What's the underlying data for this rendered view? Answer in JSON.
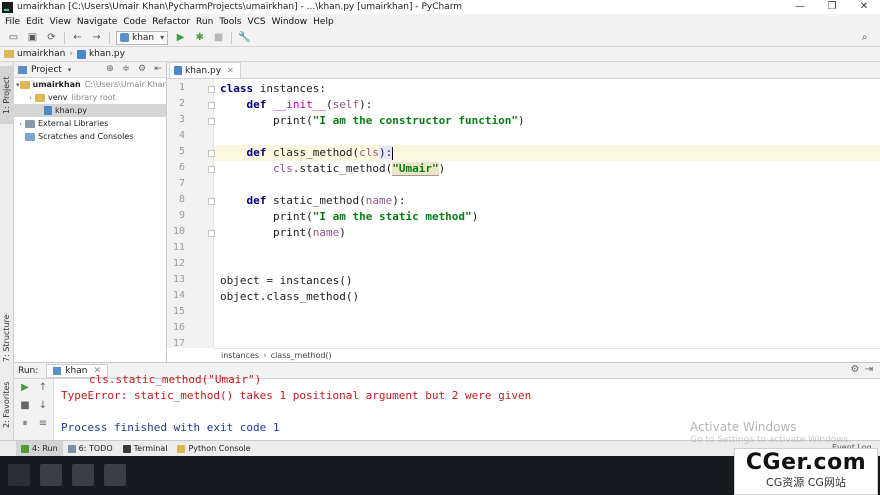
{
  "window": {
    "title": "umairkhan [C:\\Users\\Umair Khan\\PycharmProjects\\umairkhan] - ...\\khan.py [umairkhan] - PyCharm",
    "controls": [
      "—",
      "❐",
      "✕"
    ]
  },
  "menu": [
    "File",
    "Edit",
    "View",
    "Navigate",
    "Code",
    "Refactor",
    "Run",
    "Tools",
    "VCS",
    "Window",
    "Help"
  ],
  "toolbar": {
    "run_config": "khan"
  },
  "navbar": {
    "project": "umairkhan",
    "file": "khan.py"
  },
  "left_strip": {
    "project_tab": "1: Project",
    "structure_tab": "7: Structure",
    "favorites_tab": "2: Favorites"
  },
  "project_panel": {
    "title": "Project",
    "tree": {
      "root_name": "umairkhan",
      "root_path": "C:\\Users\\Umair Khan\\PycharmProjects\\umairkhan",
      "venv_name": "venv",
      "venv_note": "library root",
      "file_name": "khan.py",
      "external_libs": "External Libraries",
      "scratches": "Scratches and Consoles"
    }
  },
  "editor": {
    "tab_label": "khan.py",
    "line_numbers": [
      "1",
      "2",
      "3",
      "4",
      "5",
      "6",
      "7",
      "8",
      "9",
      "10",
      "11",
      "12",
      "13",
      "14",
      "15",
      "16",
      "17"
    ],
    "code": {
      "l1_kw": "class",
      "l1_rest": " instances:",
      "l2_kw": "def",
      "l2_name": "__init__",
      "l2_open": "(",
      "l2_self": "self",
      "l2_close": "):",
      "l3_call": "print(",
      "l3_str": "\"I am the constructor function\"",
      "l3_end": ")",
      "l5_kw": "def",
      "l5_name": " class_method(",
      "l5_param": "cls",
      "l5_end": "):",
      "l6_obj": "cls",
      "l6_call": ".static_method(",
      "l6_str": "\"Umair\"",
      "l6_end": ")",
      "l8_kw": "def",
      "l8_name": " static_method(",
      "l8_param": "name",
      "l8_end": "):",
      "l9_call": "print(",
      "l9_str": "\"I am the static method\"",
      "l9_end": ")",
      "l10_call": "print(",
      "l10_param": "name",
      "l10_end": ")",
      "l13": "object = instances()",
      "l14": "object.class_method()"
    },
    "breadcrumb_class": "instances",
    "breadcrumb_method": "class_method()"
  },
  "run_panel": {
    "label": "Run:",
    "tab": "khan",
    "console": {
      "cut_line": "cls.static_method(\"Umair\")",
      "error_line": "TypeError: static_method() takes 1 positional argument but 2 were given",
      "finish_line": "Process finished with exit code 1"
    }
  },
  "bottom_tabs": [
    "4: Run",
    "6: TODO",
    "Terminal",
    "Python Console"
  ],
  "overlay": {
    "activate_title": "Activate Windows",
    "activate_sub": "Go to Settings to activate Windows.",
    "event_log": "Event Log"
  },
  "badge": {
    "brand": "CGer.com",
    "sub": "CG资源 CG网站"
  },
  "colors": {
    "keyword": "#000080",
    "string": "#067d17",
    "error": "#c21b1b",
    "current_line": "#fcf7df"
  }
}
